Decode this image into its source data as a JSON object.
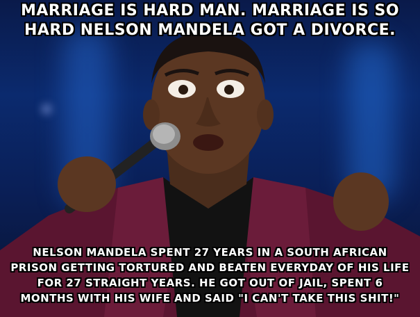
{
  "meme": {
    "top_lines": [
      "MARRIAGE IS HARD MAN. MARRIAGE IS SO",
      "HARD NELSON MANDELA GOT A DIVORCE."
    ],
    "bottom_lines": [
      "NELSON MANDELA SPENT 27 YEARS IN A SOUTH AFRICAN",
      "PRISON GETTING TORTURED AND BEATEN EVERYDAY OF HIS LIFE",
      "FOR 27 STRAIGHT YEARS. HE GOT OUT OF JAIL, SPENT 6",
      "MONTHS WITH HIS WIFE AND SAID \"I CAN'T TAKE THIS SHIT!\""
    ],
    "colors": {
      "background": "#0b2a6e",
      "text": "#ffffff",
      "outline": "#000000",
      "jacket": "#5a1530"
    }
  }
}
